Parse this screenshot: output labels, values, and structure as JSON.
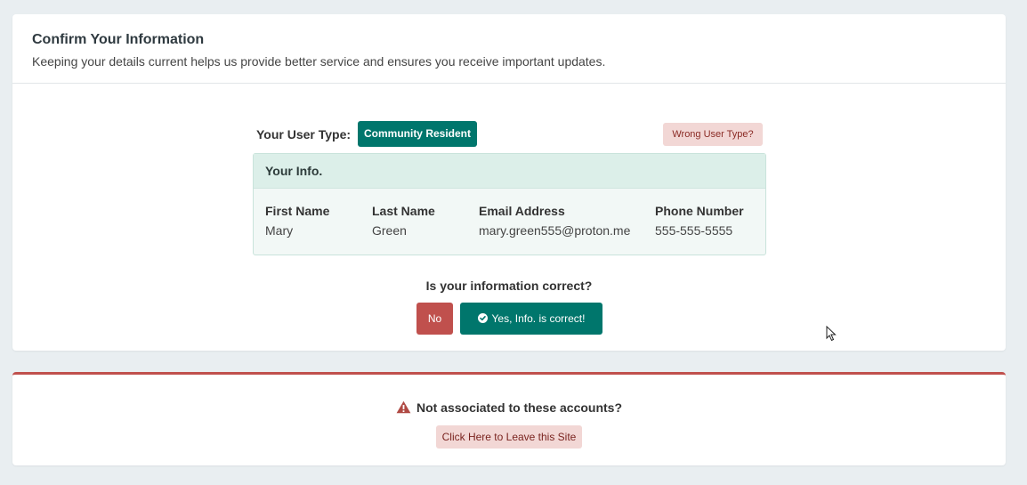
{
  "header": {
    "title": "Confirm Your Information",
    "subtitle": "Keeping your details current helps us provide better service and ensures you receive important updates."
  },
  "user_type": {
    "label": "Your User Type:",
    "value": "Community Resident",
    "wrong_button": "Wrong User Type?"
  },
  "info": {
    "panel_title": "Your Info.",
    "columns": [
      {
        "header": "First Name",
        "value": "Mary"
      },
      {
        "header": "Last Name",
        "value": "Green"
      },
      {
        "header": "Email Address",
        "value": "mary.green555@proton.me"
      },
      {
        "header": "Phone Number",
        "value": "555-555-5555"
      }
    ]
  },
  "confirm": {
    "question": "Is your information correct?",
    "no_label": "No",
    "yes_label": "Yes, Info. is correct!",
    "yes_icon": "check-circle-icon"
  },
  "warning": {
    "text": "Not associated to these accounts?",
    "icon": "warning-triangle-icon",
    "leave_button": "Click Here to Leave this Site"
  },
  "colors": {
    "accent": "#00766c",
    "danger": "#c0504d",
    "danger_light": "#f2d7d5",
    "background": "#e9eef1"
  }
}
